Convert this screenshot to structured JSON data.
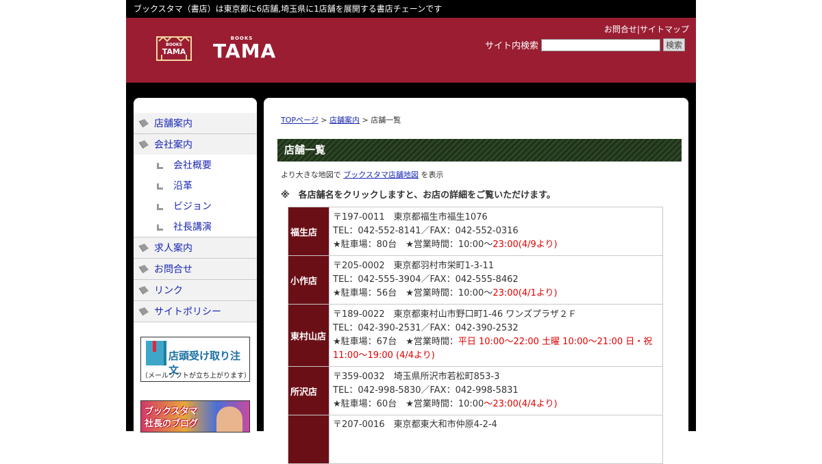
{
  "topbar": {
    "text": "ブックスタマ（書店）は東京都に6店舗,埼玉県に1店舗を展開する書店チェーンです"
  },
  "header": {
    "logo_small": "BOOKS",
    "logo_big": "TAMA",
    "contact_link": "お問合せ",
    "separator": "|",
    "sitemap_link": "サイトマップ",
    "search_label": "サイト内検索",
    "search_value": "",
    "search_button": "検索",
    "brand_color": "#9a1d32"
  },
  "sidebar": {
    "items": [
      {
        "label": "店舗案内"
      },
      {
        "label": "会社案内"
      }
    ],
    "sub_items": [
      {
        "label": "会社概要"
      },
      {
        "label": "沿革"
      },
      {
        "label": "ビジョン"
      },
      {
        "label": "社長講演"
      }
    ],
    "items2": [
      {
        "label": "求人案内"
      },
      {
        "label": "お問合せ"
      },
      {
        "label": "リンク"
      },
      {
        "label": "サイトポリシー"
      }
    ],
    "banner_order": {
      "title": "店頭受け取り注文",
      "subtitle": "（メールソフトが立ち上がります）"
    },
    "banner_blog": {
      "line1": "ブックスタマ",
      "line2": "社長のブログ"
    }
  },
  "main": {
    "breadcrumb": {
      "top": "TOPページ",
      "sep1": " > ",
      "stores": "店舗案内",
      "sep2": " > ",
      "current": "店舗一覧"
    },
    "page_title": "店舗一覧",
    "map_prefix": "より大きな地図で ",
    "map_link": "ブックスタマ店舗地図",
    "map_suffix": " を表示",
    "note": "※　各店舗名をクリックしますと、お店の詳細をご覧いただけます。",
    "stores": [
      {
        "name": "福生店",
        "address": "〒197-0011　東京都福生市福生1076",
        "tel": "TEL：042-552-8141／FAX：042-552-0316",
        "info_prefix": "★駐車場：80台　★営業時間：10:00～",
        "info_red": "23:00(4/9より)"
      },
      {
        "name": "小作店",
        "address": "〒205-0002　東京都羽村市栄町1-3-11",
        "tel": "TEL：042-555-3904／FAX：042-555-8462",
        "info_prefix": "★駐車場：56台　★営業時間：10:00～",
        "info_red": "23:00(4/1より)"
      },
      {
        "name": "東村山店",
        "address": "〒189-0022　東京都東村山市野口町1-46 ワンズプラザ２Ｆ",
        "tel": "TEL：042-390-2531／FAX：042-390-2532",
        "info_prefix": "★駐車場：67台　★営業時間：",
        "info_red": "平日 10:00～22:00 土曜 10:00～21:00 日・祝 11:00～19:00 (4/4より)"
      },
      {
        "name": "所沢店",
        "address": "〒359-0032　埼玉県所沢市若松町853-3",
        "tel": "TEL：042-998-5830／FAX：042-998-5831",
        "info_prefix": "★駐車場：60台　★営業時間：10:00",
        "info_red": "～23:00(4/4より)"
      },
      {
        "name": "",
        "address": "〒207-0016　東京都東大和市仲原4-2-4",
        "tel": "",
        "info_prefix": "",
        "info_red": ""
      }
    ]
  }
}
